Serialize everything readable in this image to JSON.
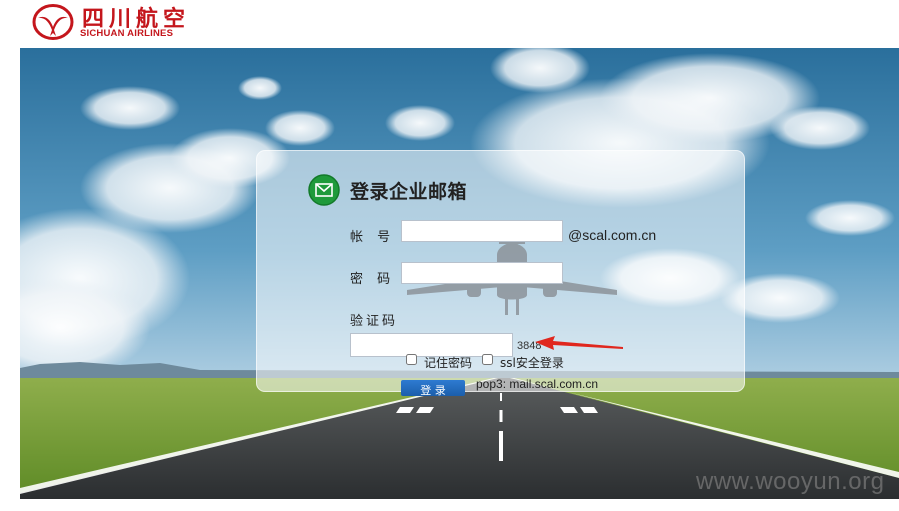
{
  "brand": {
    "name_cn": "四川航空",
    "name_en": "SICHUAN AIRLINES",
    "color": "#c4161c",
    "logo_icon": "swallow-logo-icon"
  },
  "login": {
    "title": "登录企业邮箱",
    "title_icon": "envelope-icon",
    "account_label": "帐 号",
    "account_value": "",
    "domain_suffix": "@scal.com.cn",
    "password_label": "密 码",
    "password_value": "",
    "captcha_label": "验证码",
    "captcha_value": "",
    "captcha_code": "3848",
    "remember_label": "记住密码",
    "ssl_label": "ssl安全登录",
    "submit_label": "登 录",
    "pop3_info": "pop3: mail.scal.com.cn",
    "accent_color": "#2e7bd1"
  },
  "watermark": "www.wooyun.org"
}
